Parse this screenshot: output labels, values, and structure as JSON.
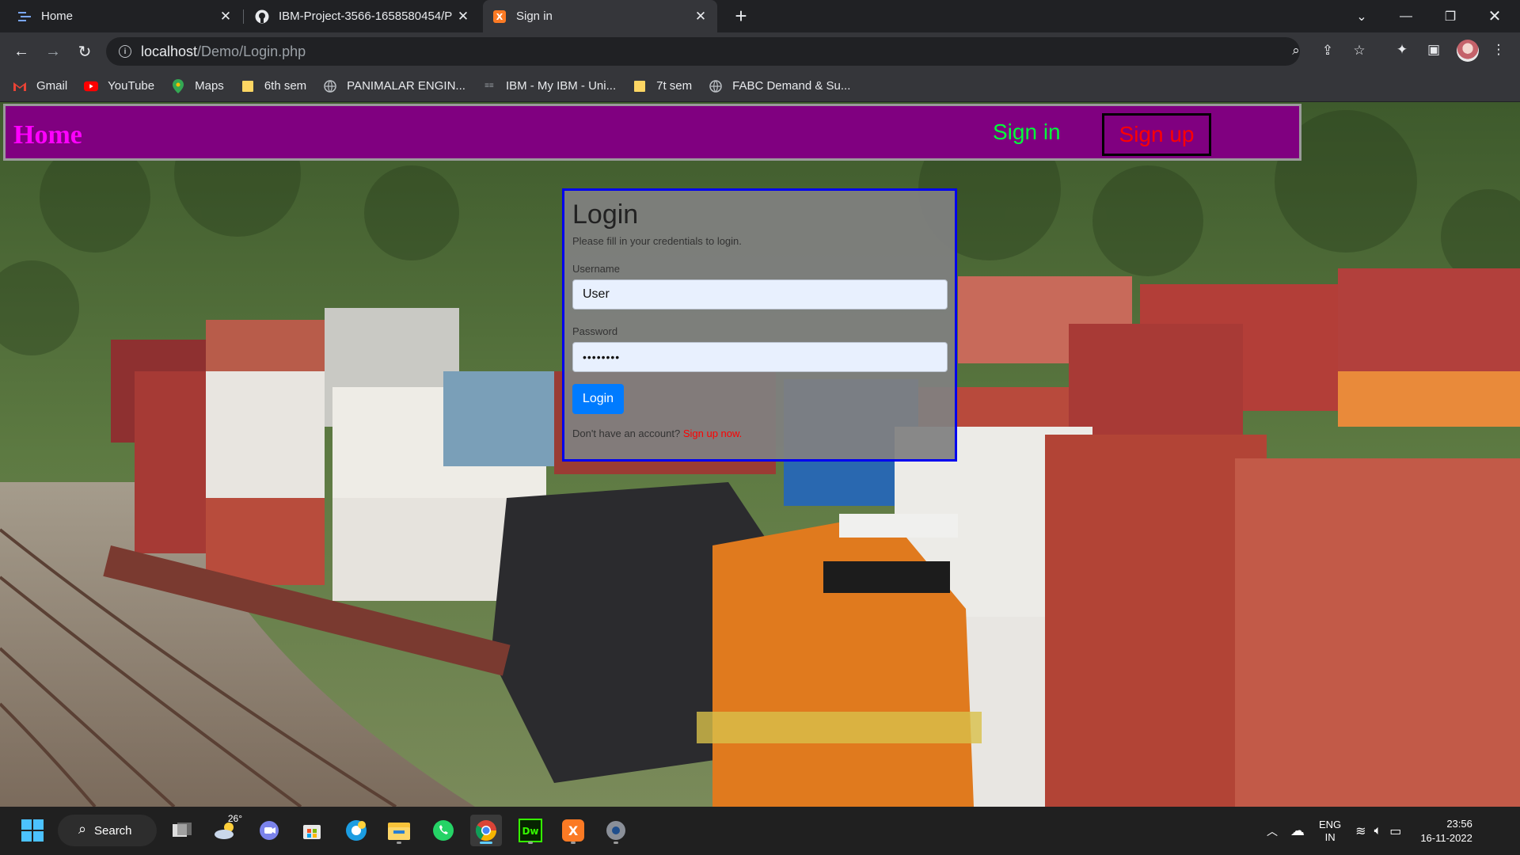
{
  "browser": {
    "tabs": [
      {
        "title": "Home",
        "favicon": "page-lines-icon",
        "active": false
      },
      {
        "title": "IBM-Project-3566-1658580454/P",
        "favicon": "github-icon",
        "active": false
      },
      {
        "title": "Sign in",
        "favicon": "xampp-icon",
        "active": true
      }
    ],
    "url_host": "localhost",
    "url_path": "/Demo/Login.php",
    "bookmarks": [
      {
        "label": "Gmail",
        "icon": "gmail-icon"
      },
      {
        "label": "YouTube",
        "icon": "youtube-icon"
      },
      {
        "label": "Maps",
        "icon": "maps-icon"
      },
      {
        "label": "6th sem",
        "icon": "folder-icon"
      },
      {
        "label": "PANIMALAR ENGIN...",
        "icon": "globe-icon"
      },
      {
        "label": "IBM - My IBM - Uni...",
        "icon": "ibm-icon"
      },
      {
        "label": "7t sem",
        "icon": "folder-icon"
      },
      {
        "label": "FABC Demand & Su...",
        "icon": "globe-icon"
      }
    ]
  },
  "page": {
    "nav": {
      "home": "Home",
      "signin": "Sign in",
      "signup": "Sign up"
    },
    "login": {
      "title": "Login",
      "subtitle": "Please fill in your credentials to login.",
      "username_label": "Username",
      "username_value": "User",
      "password_label": "Password",
      "password_value": "••••••••",
      "button": "Login",
      "footer_text": "Don't have an account?",
      "footer_link": "Sign up now."
    },
    "colors": {
      "navbar": "#800080",
      "home": "#ff00ff",
      "signin": "#00ff3a",
      "signup": "#ff0000",
      "login_button": "#007bff",
      "login_border": "#0000ee"
    }
  },
  "taskbar": {
    "search_label": "Search",
    "weather_temp": "26°",
    "lang_line1": "ENG",
    "lang_line2": "IN",
    "time": "23:56",
    "date": "16-11-2022"
  }
}
